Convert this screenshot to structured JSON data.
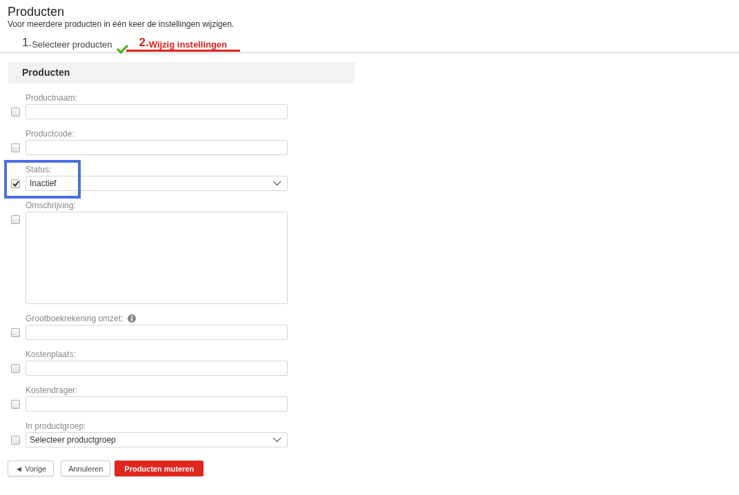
{
  "page": {
    "title": "Producten",
    "subtitle": "Voor meerdere producten in één keer de instellingen wijzigen."
  },
  "steps": [
    {
      "number": "1.",
      "label": "Selecteer producten",
      "selected": false,
      "done": true
    },
    {
      "number": "2.",
      "label": "Wijzig instellingen",
      "selected": true,
      "done": false
    }
  ],
  "section": {
    "title": "Producten"
  },
  "fields": [
    {
      "kind": "text",
      "label": "Productnaam:",
      "checked": false,
      "highlighted": false,
      "info": false
    },
    {
      "kind": "text",
      "label": "Productcode:",
      "checked": false,
      "highlighted": false,
      "info": false
    },
    {
      "kind": "select",
      "label": "Status:",
      "value": "Inactief",
      "checked": true,
      "highlighted": true,
      "info": false
    },
    {
      "kind": "textarea",
      "label": "Omschrijving:",
      "checked": false,
      "highlighted": false,
      "info": false
    },
    {
      "kind": "text",
      "label": "Grootboekrekening omzet:",
      "checked": false,
      "highlighted": false,
      "info": true
    },
    {
      "kind": "text",
      "label": "Kostenplaats:",
      "checked": false,
      "highlighted": false,
      "info": false
    },
    {
      "kind": "text",
      "label": "Kostendrager:",
      "checked": false,
      "highlighted": false,
      "info": false
    },
    {
      "kind": "select",
      "label": "In productgroep:",
      "value": "Selecteer productgroep",
      "checked": false,
      "highlighted": false,
      "info": false
    }
  ],
  "buttons": [
    {
      "label": "◄ Vorige",
      "kind": "default"
    },
    {
      "label": "Annuleren",
      "kind": "default"
    },
    {
      "label": "Producten muteren",
      "kind": "primary"
    }
  ]
}
